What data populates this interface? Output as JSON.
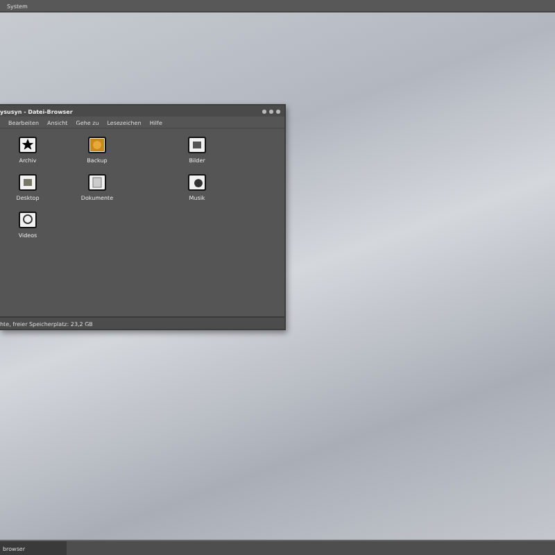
{
  "top_panel": {
    "menu": "System"
  },
  "window": {
    "title": "ysusyn - Datei-Browser",
    "menu": [
      "Bearbeiten",
      "Ansicht",
      "Gehe zu",
      "Lesezeichen",
      "Hilfe"
    ],
    "items": [
      {
        "label": "Archiv",
        "kind": "star"
      },
      {
        "label": "Backup",
        "kind": "face"
      },
      {
        "label": "Bilder",
        "kind": "picture"
      },
      {
        "label": "Desktop",
        "kind": "desktop"
      },
      {
        "label": "Dokumente",
        "kind": "document"
      },
      {
        "label": "Musik",
        "kind": "music"
      },
      {
        "label": "Videos",
        "kind": "video"
      }
    ],
    "status_bar": "hte, freier Speicherplatz: 23,2 GB"
  },
  "taskbar": {
    "buttons": [
      {
        "label": "browser",
        "selected": true
      }
    ]
  }
}
